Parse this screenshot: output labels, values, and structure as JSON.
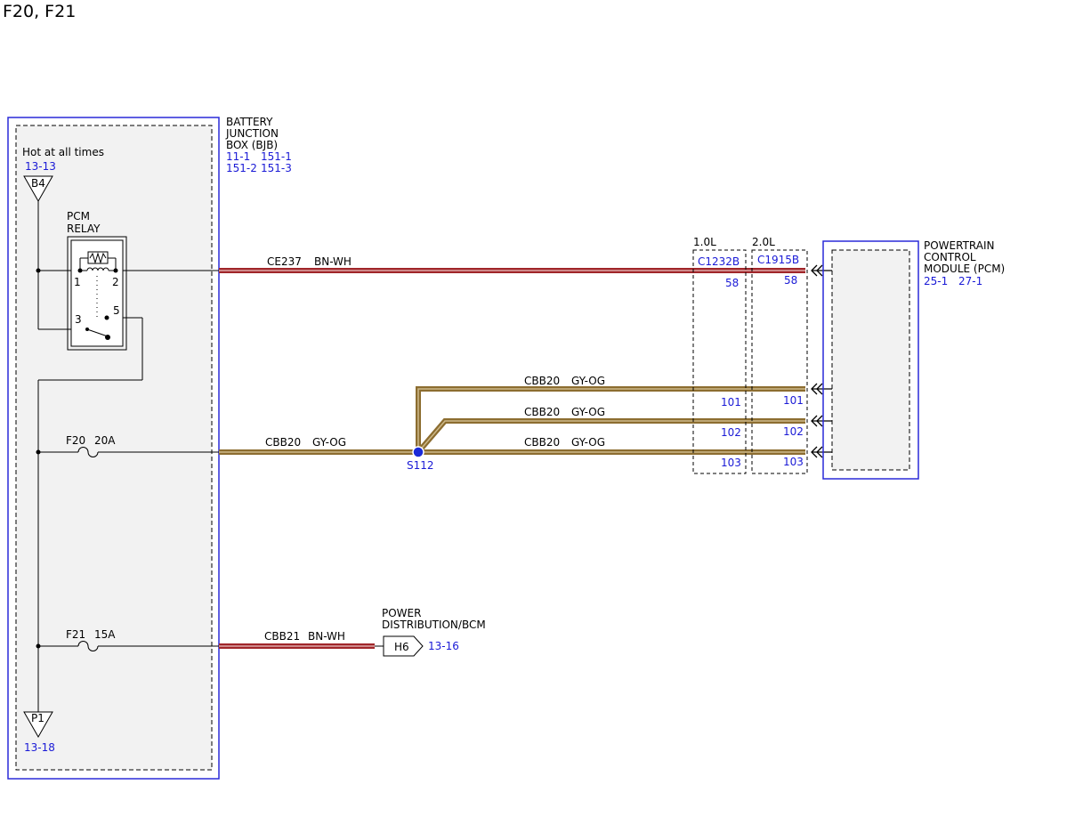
{
  "page_title": "F20, F21",
  "colors": {
    "wire_bn_wh": "#a0262a",
    "wire_gy_og": "#b38a3c",
    "module_outline": "#2a2ad8",
    "ref_text": "#1a1ad6",
    "box_fill": "#f2f2f2"
  },
  "bjb": {
    "label_lines": [
      "BATTERY",
      "JUNCTION",
      "BOX (BJB)"
    ],
    "refs_row1": [
      "11-1",
      "151-1"
    ],
    "refs_row2": [
      "151-2",
      "151-3"
    ]
  },
  "hot_label": "Hot at all times",
  "hot_ref": "13-13",
  "b4_label": "B4",
  "p1_label": "P1",
  "p1_ref": "13-18",
  "relay": {
    "label_lines": [
      "PCM",
      "RELAY"
    ],
    "pins": [
      "1",
      "2",
      "3",
      "5"
    ]
  },
  "fuses": [
    {
      "name": "F20",
      "rating": "20A"
    },
    {
      "name": "F21",
      "rating": "15A"
    }
  ],
  "circuits": {
    "ce237": {
      "id": "CE237",
      "color": "BN-WH"
    },
    "cbb20": {
      "id": "CBB20",
      "color": "GY-OG"
    },
    "cbb21": {
      "id": "CBB21",
      "color": "BN-WH"
    }
  },
  "splice": "S112",
  "connectors": [
    {
      "engine": "1.0L",
      "name": "C1232B",
      "pins": [
        "58",
        "101",
        "102",
        "103"
      ]
    },
    {
      "engine": "2.0L",
      "name": "C1915B",
      "pins": [
        "58",
        "101",
        "102",
        "103"
      ]
    }
  ],
  "pcm": {
    "label_lines": [
      "POWERTRAIN",
      "CONTROL",
      "MODULE (PCM)"
    ],
    "refs": [
      "25-1",
      "27-1"
    ]
  },
  "power_dist": {
    "label_lines": [
      "POWER",
      "DISTRIBUTION/BCM"
    ],
    "connector": "H6",
    "ref": "13-16"
  }
}
